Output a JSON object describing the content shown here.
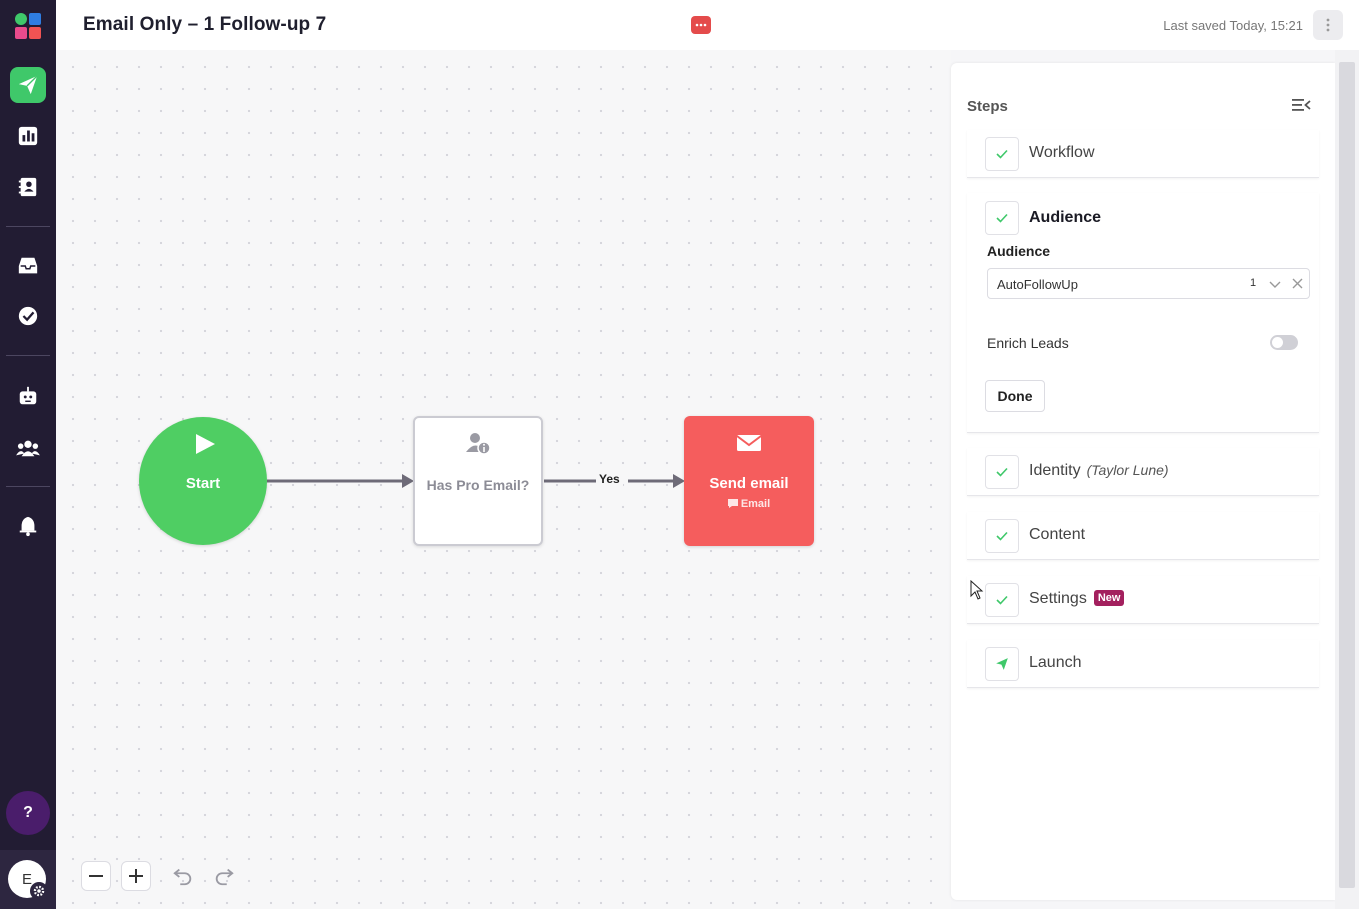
{
  "header": {
    "title": "Email Only – 1 Follow-up 7",
    "last_saved": "Last saved Today, 15:21"
  },
  "nav": {
    "avatar_initial": "E",
    "help_label": "?",
    "items": [
      "send-icon",
      "chart-icon",
      "contacts-icon",
      "inbox-icon",
      "tasks-icon",
      "bot-icon",
      "team-icon",
      "bell-icon"
    ]
  },
  "workflow": {
    "start_label": "Start",
    "condition_label": "Has Pro Email?",
    "edge_label": "Yes",
    "send_label": "Send email",
    "send_sub": "Email"
  },
  "steps": {
    "title": "Steps",
    "workflow": "Workflow",
    "audience": {
      "heading": "Audience",
      "field_label": "Audience",
      "selected": "AutoFollowUp",
      "count": "1",
      "enrich_label": "Enrich Leads",
      "enrich_enabled": false,
      "done_label": "Done"
    },
    "identity": "Identity",
    "identity_sub": "(Taylor Lune)",
    "content": "Content",
    "settings": "Settings",
    "settings_badge": "New",
    "launch": "Launch"
  },
  "colors": {
    "nav_bg": "#221c33",
    "accent_green": "#3fc86a",
    "start_green": "#4fce63",
    "send_red": "#f55d5d",
    "badge_purple": "#a3205e"
  }
}
